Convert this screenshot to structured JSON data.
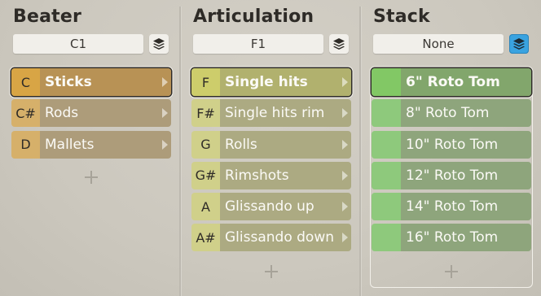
{
  "beater": {
    "title": "Beater",
    "selector_value": "C1",
    "items": [
      {
        "key": "C",
        "label": "Sticks"
      },
      {
        "key": "C#",
        "label": "Rods"
      },
      {
        "key": "D",
        "label": "Mallets"
      }
    ]
  },
  "articulation": {
    "title": "Articulation",
    "selector_value": "F1",
    "items": [
      {
        "key": "F",
        "label": "Single hits"
      },
      {
        "key": "F#",
        "label": "Single hits rim"
      },
      {
        "key": "G",
        "label": "Rolls"
      },
      {
        "key": "G#",
        "label": "Rimshots"
      },
      {
        "key": "A",
        "label": "Glissando up"
      },
      {
        "key": "A#",
        "label": "Glissando down"
      }
    ]
  },
  "stack": {
    "title": "Stack",
    "selector_value": "None",
    "items": [
      {
        "label": "6\" Roto Tom"
      },
      {
        "label": "8\" Roto Tom"
      },
      {
        "label": "10\" Roto Tom"
      },
      {
        "label": "12\" Roto Tom"
      },
      {
        "label": "14\" Roto Tom"
      },
      {
        "label": "16\" Roto Tom"
      }
    ]
  },
  "colors": {
    "stack_button_active": "#3aa3e0",
    "beater_accent": "#d8a545",
    "articulation_accent": "#cdcd6b",
    "stack_accent": "#82c865"
  },
  "icons": {
    "stack_toggle": "layers-icon",
    "add": "plus-icon",
    "submenu": "chevron-right-icon"
  }
}
